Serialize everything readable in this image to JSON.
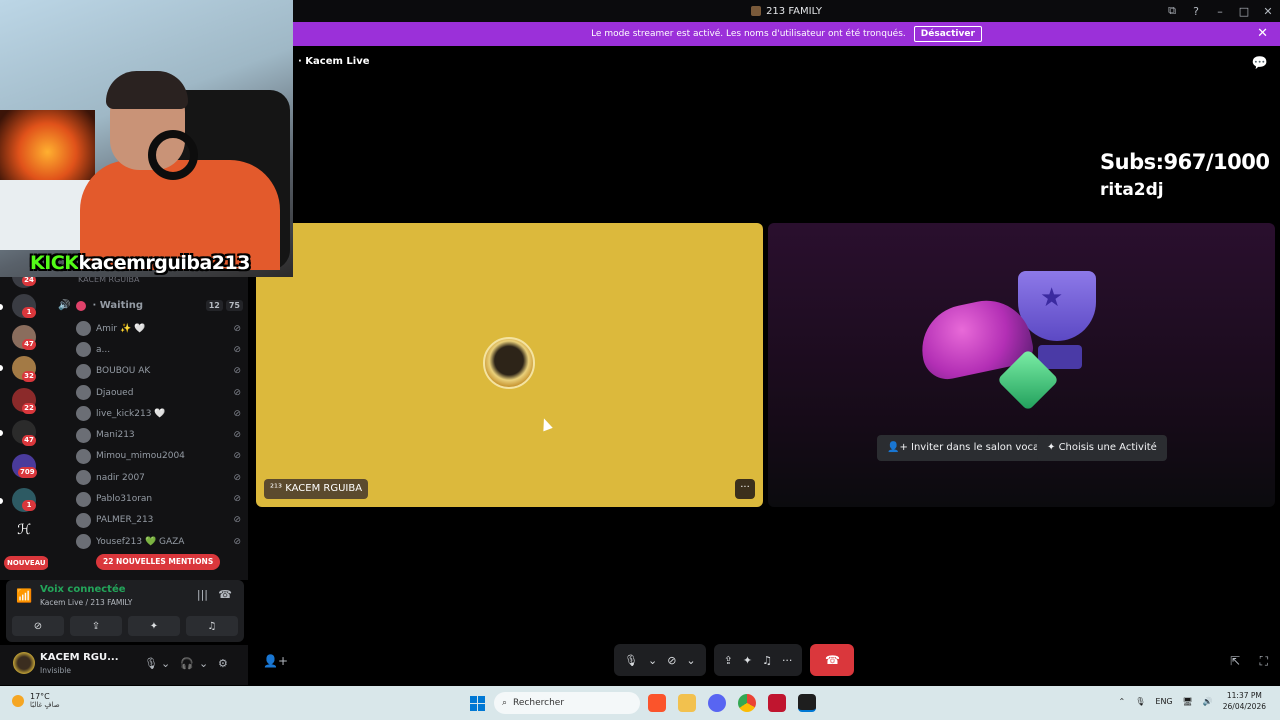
{
  "window": {
    "title": "213 FAMILY",
    "controls": [
      "⧉",
      "?",
      "–",
      "□",
      "✕"
    ]
  },
  "banner": {
    "text": "Le mode streamer est activé. Les noms d'utilisateur ont été tronqués.",
    "button": "Désactiver",
    "color": "#9b30d9"
  },
  "webcam": {
    "brand": "KICK",
    "handle": "kacemrguiba213"
  },
  "servers": [
    {
      "badge": "24"
    },
    {
      "badge": "1"
    },
    {
      "badge": "47"
    },
    {
      "badge": "32"
    },
    {
      "badge": "22"
    },
    {
      "badge": "47"
    },
    {
      "badge": "709"
    },
    {
      "badge": "1"
    },
    {
      "badge": ""
    }
  ],
  "nouveau_label": "NOUVEAU",
  "channel": {
    "previous_user": "KACEM RGUIBA",
    "name": "Waiting",
    "count_left": "12",
    "count_right": "75",
    "users": [
      {
        "name": "Amir ✨ 🤍"
      },
      {
        "name": "a..."
      },
      {
        "name": "BOUBOU AK"
      },
      {
        "name": "Djaoued"
      },
      {
        "name": "live_kick213 🤍"
      },
      {
        "name": "Mani213"
      },
      {
        "name": "Mimou_mimou2004"
      },
      {
        "name": "nadir 2007"
      },
      {
        "name": "Pablo31oran"
      },
      {
        "name": "PALMER_213"
      },
      {
        "name": "Yousef213 💚 GAZA"
      }
    ],
    "mentions_label": "22 NOUVELLES MENTIONS"
  },
  "voice_panel": {
    "title": "Voix connectée",
    "subtitle": "Kacem Live / 213 FAMILY"
  },
  "user_panel": {
    "name": "KACEM RGU...",
    "status": "Invisible"
  },
  "stage": {
    "channel_name": "Kacem Live",
    "subs_text": "Subs:967/1000",
    "overlay_name": "rita2dj",
    "participant_tag": "KACEM RGUIBA",
    "participant_color": "#dcb93c",
    "invite_button": "Inviter dans le salon vocal",
    "activity_button": "Choisis une Activité"
  },
  "taskbar": {
    "temperature": "17°C",
    "weather_text": "صافٍ غالبًا",
    "search_placeholder": "Rechercher",
    "language": "ENG",
    "time": "11:37 PM",
    "date": "26/04/2026"
  }
}
